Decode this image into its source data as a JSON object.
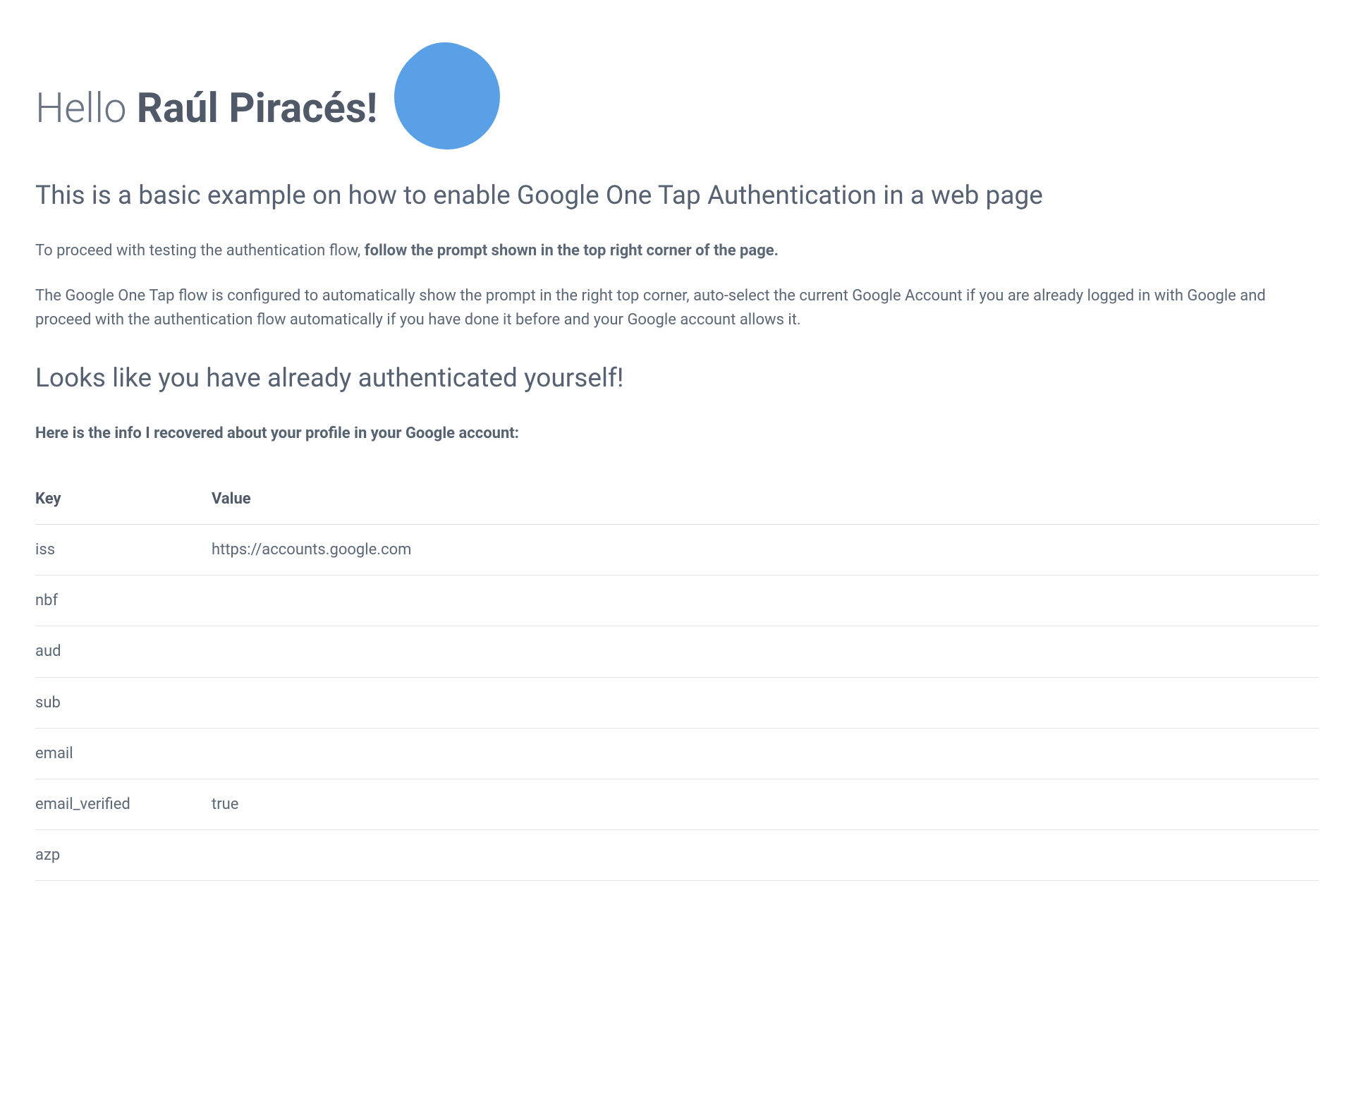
{
  "greeting": {
    "hello": "Hello ",
    "name": "Raúl Piracés!"
  },
  "subtitle": "This is a basic example on how to enable Google One Tap Authentication in a web page",
  "instruction": {
    "prefix": "To proceed with testing the authentication flow, ",
    "bold": "follow the prompt shown in the top right corner of the page."
  },
  "description": "The Google One Tap flow is configured to automatically show the prompt in the right top corner, auto-select the current Google Account if you are already logged in with Google and proceed with the authentication flow automatically if you have done it before and your Google account allows it.",
  "authHeading": "Looks like you have already authenticated yourself!",
  "profileIntro": "Here is the info I recovered about your profile in your Google account:",
  "table": {
    "headers": {
      "key": "Key",
      "value": "Value"
    },
    "rows": [
      {
        "key": "iss",
        "value": "https://accounts.google.com"
      },
      {
        "key": "nbf",
        "value": ""
      },
      {
        "key": "aud",
        "value": ""
      },
      {
        "key": "sub",
        "value": ""
      },
      {
        "key": "email",
        "value": ""
      },
      {
        "key": "email_verified",
        "value": "true"
      },
      {
        "key": "azp",
        "value": ""
      }
    ]
  }
}
